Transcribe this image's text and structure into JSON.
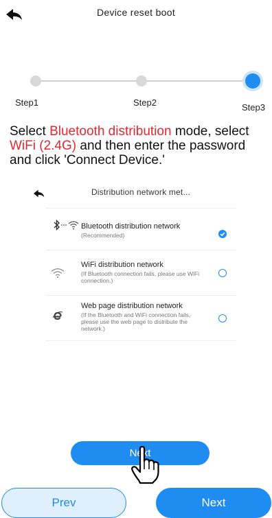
{
  "header": {
    "title": "Device reset boot"
  },
  "steps": [
    {
      "label": "Step1",
      "active": false
    },
    {
      "label": "Step2",
      "active": false
    },
    {
      "label": "Step3",
      "active": true
    }
  ],
  "instruction": {
    "p1": "Select ",
    "h1": "Bluetooth distribution",
    "p2": " mode, select ",
    "h2": "WiFi (2.4G)",
    "p3": " and then enter the password and click 'Connect Device.'",
    "highlight_color": "#e8262e"
  },
  "inner_screen": {
    "title": "Distribution network met...",
    "options": [
      {
        "icon": "bluetooth-wifi-icon",
        "title": "Bluetooth distribution network",
        "desc": "(Recommended)",
        "selected": true
      },
      {
        "icon": "wifi-icon",
        "title": "WiFi distribution network",
        "desc": "(If Bluetooth connection fails, please use WiFi connection.)",
        "selected": false
      },
      {
        "icon": "browser-e-icon",
        "title": "Web page distribution network",
        "desc": "(If the Bluetooth and WiFi connection fails, please use the web page to distribute the network.)",
        "selected": false
      }
    ],
    "next_label": "Next"
  },
  "footer": {
    "prev_label": "Prev",
    "next_label": "Next"
  },
  "colors": {
    "accent": "#1e8cf0",
    "highlight": "#e8262e"
  }
}
